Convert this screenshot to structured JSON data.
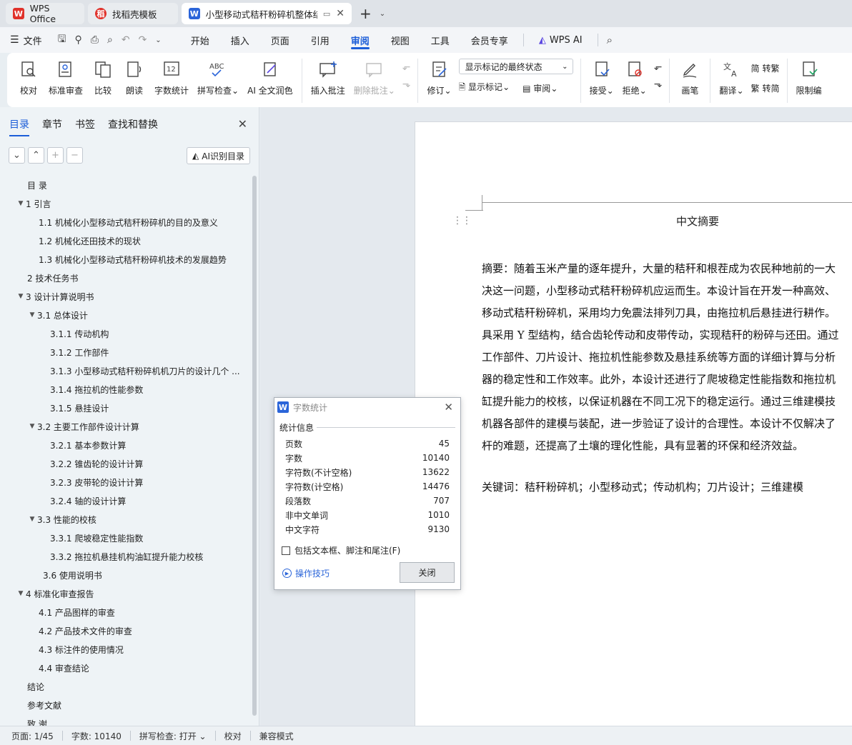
{
  "tabs": [
    {
      "label": "WPS Office",
      "logo": "W",
      "color": "#e0322b"
    },
    {
      "label": "找稻壳模板",
      "logo": "稻",
      "color": "#e0322b"
    },
    {
      "label": "小型移动式秸秆粉碎机整体结",
      "logo": "W",
      "color": "#2b65d9"
    }
  ],
  "menu": {
    "file": "文件",
    "items": [
      "开始",
      "插入",
      "页面",
      "引用",
      "审阅",
      "视图",
      "工具",
      "会员专享"
    ],
    "active": "审阅",
    "ai": "WPS AI"
  },
  "ribbon": {
    "proofread": "校对",
    "std_review": "标准审查",
    "compare": "比较",
    "read_aloud": "朗读",
    "word_count": "字数统计",
    "spell_check": "拼写检查",
    "ai_polish": "AI 全文润色",
    "insert_comment": "插入批注",
    "delete_comment": "删除批注",
    "track": "修订",
    "display_select": "显示标记的最终状态",
    "show_markup": "显示标记",
    "review": "审阅",
    "accept": "接受",
    "reject": "拒绝",
    "pen": "画笔",
    "translate": "翻译",
    "to_trad": "转繁",
    "to_simp": "转简",
    "restrict": "限制编"
  },
  "nav": {
    "tabs": [
      "目录",
      "章节",
      "书签",
      "查找和替换"
    ],
    "ai_toc": "AI识别目录",
    "toc": [
      {
        "t": "目 录",
        "lvl": 0,
        "arrow": false
      },
      {
        "t": "1 引言",
        "lvl": 0,
        "arrow": true
      },
      {
        "t": "1.1 机械化小型移动式秸秆粉碎机的目的及意义",
        "lvl": 1,
        "arrow": false
      },
      {
        "t": "1.2 机械化还田技术的现状",
        "lvl": 1,
        "arrow": false
      },
      {
        "t": "1.3 机械化小型移动式秸秆粉碎机技术的发展趋势",
        "lvl": 1,
        "arrow": false
      },
      {
        "t": "2 技术任务书",
        "lvl": 0,
        "arrow": false
      },
      {
        "t": "3 设计计算说明书",
        "lvl": 0,
        "arrow": true
      },
      {
        "t": "3.1 总体设计",
        "lvl": 1,
        "arrow": true
      },
      {
        "t": "3.1.1 传动机构",
        "lvl": 2,
        "arrow": false
      },
      {
        "t": "3.1.2 工作部件",
        "lvl": 2,
        "arrow": false
      },
      {
        "t": "3.1.3 小型移动式秸秆粉碎机机刀片的设计几个 ...",
        "lvl": 2,
        "arrow": false
      },
      {
        "t": "3.1.4 拖拉机的性能参数",
        "lvl": 2,
        "arrow": false
      },
      {
        "t": "3.1.5 悬挂设计",
        "lvl": 2,
        "arrow": false
      },
      {
        "t": "3.2 主要工作部件设计计算",
        "lvl": 1,
        "arrow": true
      },
      {
        "t": "3.2.1 基本参数计算",
        "lvl": 2,
        "arrow": false
      },
      {
        "t": "3.2.2 锥齿轮的设计计算",
        "lvl": 2,
        "arrow": false
      },
      {
        "t": "3.2.3 皮带轮的设计计算",
        "lvl": 2,
        "arrow": false
      },
      {
        "t": "3.2.4 轴的设计计算",
        "lvl": 2,
        "arrow": false
      },
      {
        "t": "3.3 性能的校核",
        "lvl": 1,
        "arrow": true
      },
      {
        "t": "3.3.1 爬坡稳定性能指数",
        "lvl": 2,
        "arrow": false
      },
      {
        "t": "3.3.2 拖拉机悬挂机构油缸提升能力校核",
        "lvl": 2,
        "arrow": false
      },
      {
        "t": "3.6 使用说明书",
        "lvl": 3,
        "arrow": false
      },
      {
        "t": "4 标准化审查报告",
        "lvl": 0,
        "arrow": true
      },
      {
        "t": "4.1 产品图样的审查",
        "lvl": 1,
        "arrow": false
      },
      {
        "t": "4.2 产品技术文件的审查",
        "lvl": 1,
        "arrow": false
      },
      {
        "t": "4.3 标注件的使用情况",
        "lvl": 1,
        "arrow": false
      },
      {
        "t": "4.4 审查结论",
        "lvl": 1,
        "arrow": false
      },
      {
        "t": "结论",
        "lvl": 0,
        "arrow": false
      },
      {
        "t": "参考文献",
        "lvl": 0,
        "arrow": false
      },
      {
        "t": "致 谢",
        "lvl": 0,
        "arrow": false
      }
    ]
  },
  "doc": {
    "title": "中文摘要",
    "lines": [
      "摘要：随着玉米产量的逐年提升，大量的秸秆和根茬成为农民种地前的一大",
      "决这一问题，小型移动式秸秆粉碎机应运而生。本设计旨在开发一种高效、",
      "移动式秸秆粉碎机，采用均力免震法排列刀具，由拖拉机后悬挂进行耕作。",
      "具采用 Y 型结构，结合齿轮传动和皮带传动，实现秸秆的粉碎与还田。通过",
      "工作部件、刀片设计、拖拉机性能参数及悬挂系统等方面的详细计算与分析",
      "器的稳定性和工作效率。此外，本设计还进行了爬坡稳定性能指数和拖拉机",
      "缸提升能力的校核，以保证机器在不同工况下的稳定运行。通过三维建模技",
      "机器各部件的建模与装配，进一步验证了设计的合理性。本设计不仅解决了",
      "杆的难题，还提高了土壤的理化性能，具有显著的环保和经济效益。"
    ],
    "keywords": "关键词：秸秆粉碎机；小型移动式；传动机构；刀片设计；三维建模"
  },
  "dialog": {
    "title": "字数统计",
    "section": "统计信息",
    "stats": [
      {
        "label": "页数",
        "value": "45"
      },
      {
        "label": "字数",
        "value": "10140"
      },
      {
        "label": "字符数(不计空格)",
        "value": "13622"
      },
      {
        "label": "字符数(计空格)",
        "value": "14476"
      },
      {
        "label": "段落数",
        "value": "707"
      },
      {
        "label": "非中文单词",
        "value": "1010"
      },
      {
        "label": "中文字符",
        "value": "9130"
      }
    ],
    "checkbox": "包括文本框、脚注和尾注(F)",
    "tips": "操作技巧",
    "close": "关闭"
  },
  "status": {
    "page": "页面: 1/45",
    "words": "字数: 10140",
    "spell": "拼写检查: 打开",
    "proof": "校对",
    "compat": "兼容模式"
  }
}
